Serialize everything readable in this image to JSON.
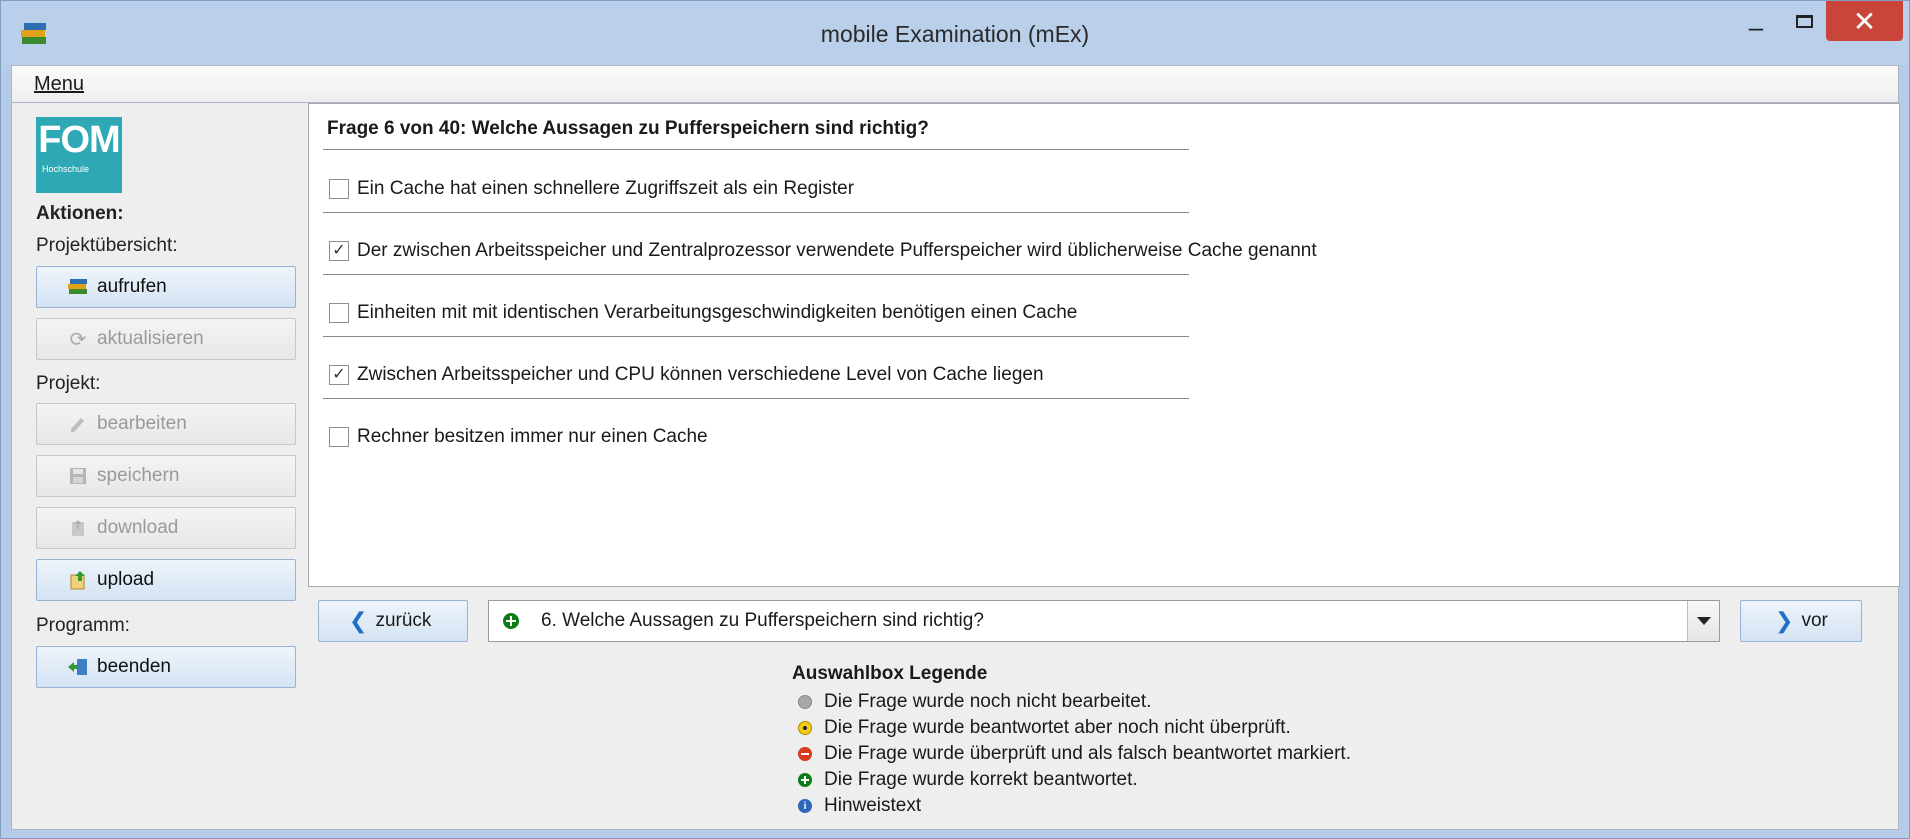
{
  "window": {
    "title": "mobile Examination (mEx)"
  },
  "menubar": {
    "menu_label": "Menu"
  },
  "sidebar": {
    "logo_text": "FOM",
    "logo_subtext": "Hochschule",
    "actions_heading": "Aktionen:",
    "projektuebersicht_label": "Projektübersicht:",
    "aufrufen": "aufrufen",
    "aktualisieren": "aktualisieren",
    "projekt_label": "Projekt:",
    "bearbeiten": "bearbeiten",
    "speichern": "speichern",
    "download": "download",
    "upload": "upload",
    "programm_label": "Programm:",
    "beenden": "beenden"
  },
  "question": {
    "title": "Frage 6 von 40: Welche Aussagen zu Pufferspeichern sind richtig?",
    "options": [
      {
        "label": "Ein Cache hat einen schnellere Zugriffszeit als ein Register",
        "checked": false
      },
      {
        "label": "Der zwischen Arbeitsspeicher und Zentralprozessor verwendete Pufferspeicher wird üblicherweise Cache genannt",
        "checked": true
      },
      {
        "label": "Einheiten mit mit identischen Verarbeitungsgeschwindigkeiten benötigen einen Cache",
        "checked": false
      },
      {
        "label": "Zwischen Arbeitsspeicher und CPU können verschiedene Level von Cache liegen",
        "checked": true
      },
      {
        "label": "Rechner besitzen immer nur einen Cache",
        "checked": false
      }
    ]
  },
  "nav": {
    "back_label": "zurück",
    "next_label": "vor",
    "selected_question": "6. Welche Aussagen zu Pufferspeichern sind richtig?"
  },
  "legend": {
    "title": "Auswahlbox Legende",
    "items": [
      "Die Frage wurde noch nicht bearbeitet.",
      "Die Frage wurde beantwortet aber noch nicht überprüft.",
      "Die Frage wurde überprüft und als falsch beantwortet markiert.",
      "Die Frage wurde korrekt beantwortet.",
      "Hinweistext"
    ]
  },
  "colors": {
    "status_not_edited": "#a8a8a8",
    "status_answered": "#e8b800",
    "status_wrong": "#d83a1e",
    "status_correct": "#0e7d18",
    "status_hint": "#2f68b8",
    "close_button": "#c9453a",
    "logo": "#2fa8b5"
  },
  "icons": {
    "app": "books-icon",
    "checkmark": "✓"
  }
}
